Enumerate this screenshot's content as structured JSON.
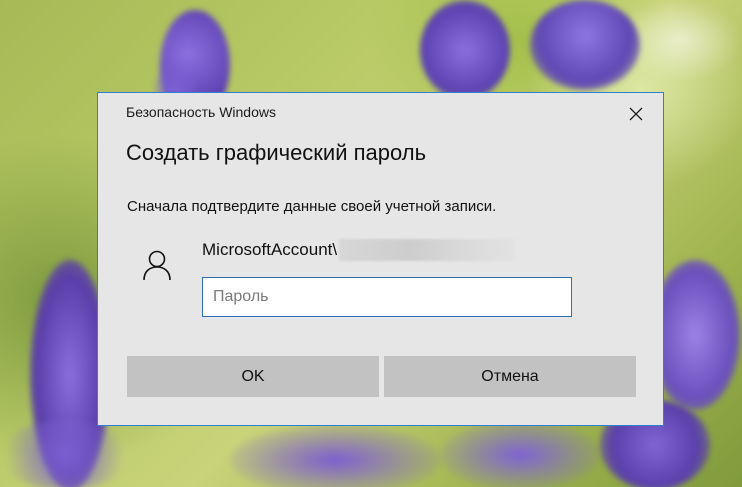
{
  "dialog": {
    "window_title": "Безопасность Windows",
    "heading": "Создать графический пароль",
    "instruction": "Сначала подтвердите данные своей учетной записи.",
    "account_prefix": "MicrosoftAccount\\",
    "password_placeholder": "Пароль",
    "password_value": "",
    "ok_label": "OK",
    "cancel_label": "Отмена",
    "close_icon": "close-icon",
    "user_icon": "user-icon"
  },
  "colors": {
    "dialog_bg": "#e6e6e6",
    "dialog_border": "#2f7fd1",
    "button_bg": "#c2c2c2",
    "input_border": "#2d6fb5",
    "wallpaper_flowers": "#7b5cc9"
  }
}
